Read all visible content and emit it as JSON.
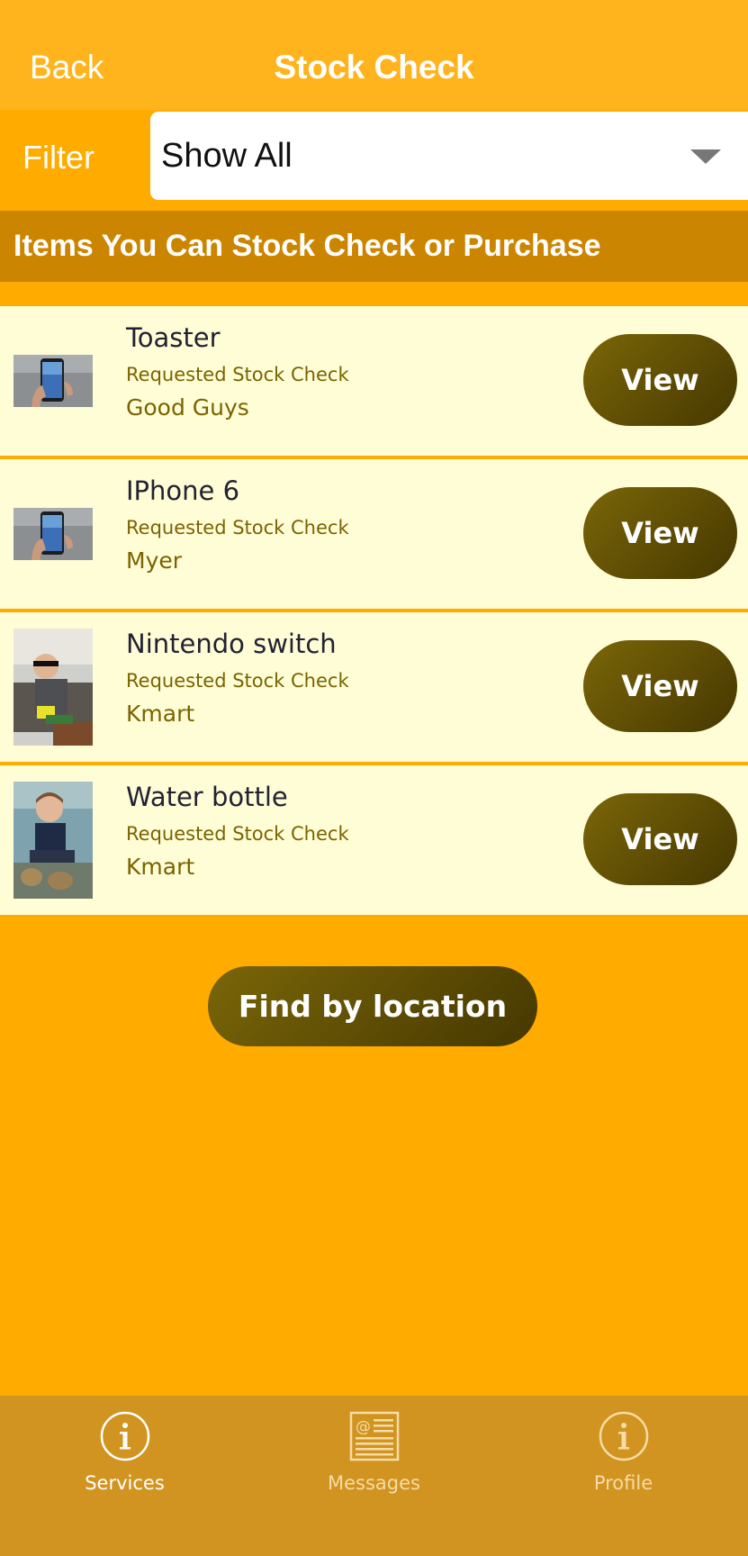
{
  "header": {
    "back_label": "Back",
    "title": "Stock Check"
  },
  "filter": {
    "label": "Filter",
    "selected": "Show All"
  },
  "section": {
    "title": "Items You Can Stock Check or Purchase"
  },
  "items": [
    {
      "name": "Toaster",
      "status": "Requested Stock Check",
      "store": "Good Guys",
      "thumbnail": "phone-in-hand-photo",
      "action": "View"
    },
    {
      "name": "IPhone 6",
      "status": "Requested Stock Check",
      "store": "Myer",
      "thumbnail": "phone-in-hand-photo",
      "action": "View"
    },
    {
      "name": "Nintendo switch",
      "status": "Requested Stock Check",
      "store": "Kmart",
      "thumbnail": "child-on-couch-photo",
      "action": "View"
    },
    {
      "name": "Water bottle",
      "status": "Requested Stock Check",
      "store": "Kmart",
      "thumbnail": "child-on-beach-photo",
      "action": "View"
    }
  ],
  "find_button": {
    "label": "Find by location"
  },
  "tabs": [
    {
      "label": "Services",
      "icon": "info-icon",
      "active": true
    },
    {
      "label": "Messages",
      "icon": "newspaper-icon",
      "active": false
    },
    {
      "label": "Profile",
      "icon": "info-icon",
      "active": false
    }
  ],
  "colors": {
    "background": "#FFAB00",
    "header": "#FFB41E",
    "section_header": "#CC8500",
    "list_item": "#FFFDD6",
    "button": "#5B4A04",
    "tab_bar": "#D19421",
    "store_text": "#7A6300"
  }
}
